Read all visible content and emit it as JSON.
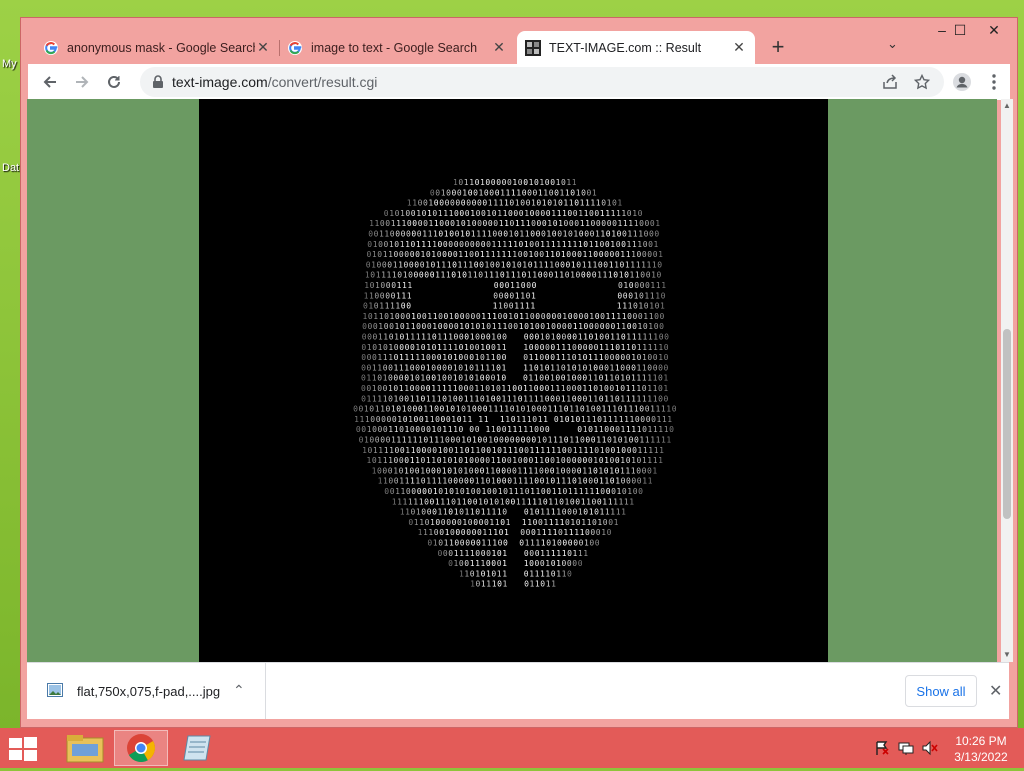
{
  "desktop": {
    "icons": [
      {
        "label": "My"
      },
      {
        "label": "Dat"
      }
    ]
  },
  "browser": {
    "tabs": [
      {
        "title": "anonymous mask - Google Search",
        "favicon": "google-g-icon"
      },
      {
        "title": "image to text - Google Search",
        "favicon": "google-g-icon"
      },
      {
        "title": "TEXT-IMAGE.com :: Result",
        "favicon": "text-image-favicon",
        "active": true
      }
    ],
    "new_tab_symbol": "+",
    "tab_search_symbol": "⌄",
    "window_controls": {
      "minimize": "–",
      "maximize": "☐",
      "close": "✕"
    },
    "address": {
      "domain": "text-image.com",
      "path": "/convert/result.cgi"
    }
  },
  "page": {
    "image_alt": "ASCII art Guy Fawkes mask made of binary digits",
    "binary_glyphs": [
      "0",
      "1"
    ]
  },
  "download_bar": {
    "file_name": "flat,750x,075,f-pad,....jpg",
    "show_all_label": "Show all",
    "close_symbol": "✕",
    "chevron_symbol": "⌃"
  },
  "taskbar": {
    "clock_time": "10:26 PM",
    "clock_date": "3/13/2022"
  },
  "colors": {
    "window_frame": "#f2a3a0",
    "taskbar": "#e35b58",
    "page_background": "#6b9a62",
    "link_blue": "#1a73e8"
  }
}
